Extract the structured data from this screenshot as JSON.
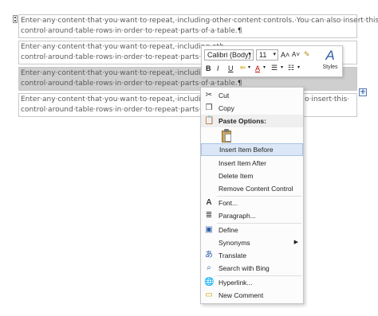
{
  "document": {
    "rows": [
      {
        "line1": "Enter·any·content·that·you·want·to·repeat,·including·other·content·controls.·You·can·also·insert·this·",
        "line2": "control·around·table·rows·in·order·to·repeat·parts·of·a·table.",
        "mark": "¶"
      },
      {
        "line1": "Enter·any·content·that·you·want·to·repeat,·including·oth",
        "line2": "control·around·table·rows·in·order·to·repeat·parts·of·a·ta",
        "mark": ""
      },
      {
        "line1": "Enter·any·content·that·you·want·to·repeat,·including·oth",
        "line2": "control·around·table·rows·in·order·to·repeat·parts·of·a·table.",
        "mark": "¶"
      },
      {
        "line1": "Enter·any·content·that·you·want·to·repeat,·including·oth",
        "line1b": "o·insert·this·",
        "line2": "control·around·table·rows·in·order·to·repeat·parts·of·a·table.",
        "mark": "¶"
      }
    ],
    "add_row_icon": "+"
  },
  "mini_toolbar": {
    "font_name": "Calibri (Body)",
    "font_size": "11",
    "grow_font": "A˄",
    "shrink_font": "A˅",
    "bold": "B",
    "italic": "I",
    "underline": "U",
    "font_color": "A",
    "styles_label": "Styles",
    "styles_glyph": "A"
  },
  "context_menu": {
    "cut": "Cut",
    "copy": "Copy",
    "paste_options": "Paste Options:",
    "insert_before": "Insert Item Before",
    "insert_after": "Insert Item After",
    "delete_item": "Delete Item",
    "remove_control": "Remove Content Control",
    "font": "Font...",
    "paragraph": "Paragraph...",
    "define": "Define",
    "synonyms": "Synonyms",
    "translate": "Translate",
    "search_bing": "Search with Bing",
    "hyperlink": "Hyperlink...",
    "new_comment": "New Comment"
  },
  "colors": {
    "selection": "#cfcfcf",
    "menu_highlight": "#dbe7f6",
    "accent": "#2f5ea8"
  }
}
